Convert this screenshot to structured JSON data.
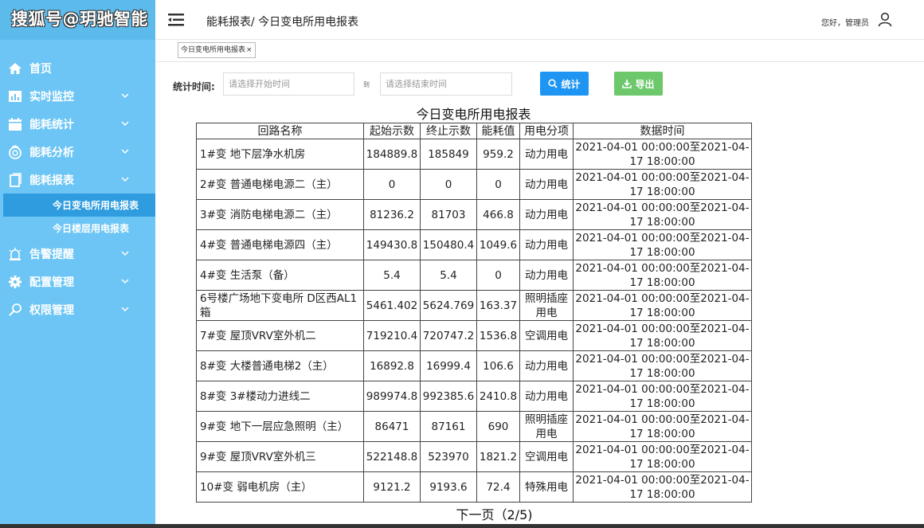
{
  "watermark": "搜狐号@玥驰智能",
  "header": {
    "breadcrumb": "能耗报表/ 今日变电所用电报表",
    "user_greeting": "您好，管理员"
  },
  "sidebar": {
    "items": [
      {
        "label": "首页",
        "icon": "home-icon"
      },
      {
        "label": "实时监控",
        "icon": "bar-chart-icon"
      },
      {
        "label": "能耗统计",
        "icon": "calendar-icon"
      },
      {
        "label": "能耗分析",
        "icon": "analysis-icon"
      },
      {
        "label": "能耗报表",
        "icon": "report-icon"
      },
      {
        "label": "告警提醒",
        "icon": "alarm-icon"
      },
      {
        "label": "配置管理",
        "icon": "gear-icon"
      },
      {
        "label": "权限管理",
        "icon": "search-key-icon"
      }
    ],
    "report_submenu": [
      "今日变电所用电报表",
      "今日楼层用电报表"
    ]
  },
  "tab": {
    "label": "今日变电所用电报表",
    "close": "×"
  },
  "filter": {
    "label": "统计时间:",
    "start_placeholder": "请选择开始时间",
    "to_label": "到",
    "end_placeholder": "请选择结束时间",
    "stat_button": "统计",
    "export_button": "导出"
  },
  "report": {
    "title": "今日变电所用电报表",
    "columns": [
      "回路名称",
      "起始示数",
      "终止示数",
      "能耗值",
      "用电分项",
      "数据时间"
    ],
    "rows": [
      [
        "1#变 地下层净水机房",
        "184889.8",
        "185849",
        "959.2",
        "动力用电",
        "2021-04-01 00:00:00至2021-04-17 18:00:00"
      ],
      [
        "2#变 普通电梯电源二（主）",
        "0",
        "0",
        "0",
        "动力用电",
        "2021-04-01 00:00:00至2021-04-17 18:00:00"
      ],
      [
        "3#变 消防电梯电源二（主）",
        "81236.2",
        "81703",
        "466.8",
        "动力用电",
        "2021-04-01 00:00:00至2021-04-17 18:00:00"
      ],
      [
        "4#变 普通电梯电源四（主）",
        "149430.8",
        "150480.4",
        "1049.6",
        "动力用电",
        "2021-04-01 00:00:00至2021-04-17 18:00:00"
      ],
      [
        "4#变 生活泵（备）",
        "5.4",
        "5.4",
        "0",
        "动力用电",
        "2021-04-01 00:00:00至2021-04-17 18:00:00"
      ],
      [
        "6号楼广场地下变电所 D区西AL1箱",
        "5461.402",
        "5624.769",
        "163.37",
        "照明插座用电",
        "2021-04-01 00:00:00至2021-04-17 18:00:00"
      ],
      [
        "7#变 屋顶VRV室外机二",
        "719210.4",
        "720747.2",
        "1536.8",
        "空调用电",
        "2021-04-01 00:00:00至2021-04-17 18:00:00"
      ],
      [
        "8#变 大楼普通电梯2（主）",
        "16892.8",
        "16999.4",
        "106.6",
        "动力用电",
        "2021-04-01 00:00:00至2021-04-17 18:00:00"
      ],
      [
        "8#变 3#楼动力进线二",
        "989974.8",
        "992385.6",
        "2410.8",
        "动力用电",
        "2021-04-01 00:00:00至2021-04-17 18:00:00"
      ],
      [
        "9#变 地下一层应急照明（主）",
        "86471",
        "87161",
        "690",
        "照明插座用电",
        "2021-04-01 00:00:00至2021-04-17 18:00:00"
      ],
      [
        "9#变 屋顶VRV室外机三",
        "522148.8",
        "523970",
        "1821.2",
        "空调用电",
        "2021-04-01 00:00:00至2021-04-17 18:00:00"
      ],
      [
        "10#变 弱电机房（主）",
        "9121.2",
        "9193.6",
        "72.4",
        "特殊用电",
        "2021-04-01 00:00:00至2021-04-17 18:00:00"
      ]
    ]
  },
  "pager": {
    "label": "下一页（2/5)"
  },
  "colors": {
    "sidebar": "#6cc5f4",
    "sidebar_active": "#2e9cdf",
    "stat_button": "#1e95f2",
    "export_button": "#6cc86b"
  }
}
